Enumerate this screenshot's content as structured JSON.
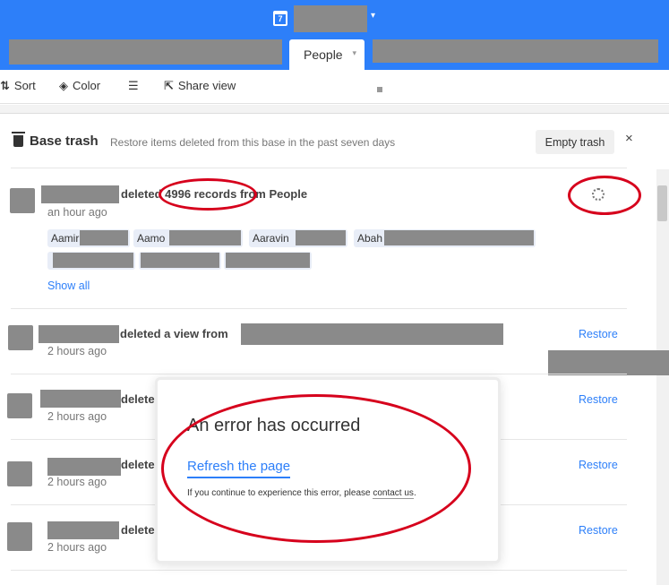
{
  "header": {
    "calendar_icon_day": "7",
    "base_menu_caret": "▾",
    "active_tab": {
      "label": "People",
      "caret": "▾"
    }
  },
  "toolbar": {
    "sort_label": "Sort",
    "color_label": "Color",
    "share_view_label": "Share view"
  },
  "trash_panel": {
    "title": "Base trash",
    "subtitle": "Restore items deleted from this base in the past seven days",
    "empty_button": "Empty trash",
    "close": "×",
    "entries": [
      {
        "action": "deleted 4996 records from People",
        "time": "an hour ago",
        "chips": [
          "Aamir",
          "Aamo",
          "Aaravin",
          "Abah"
        ],
        "show_all": "Show all",
        "restore": ""
      },
      {
        "action": "deleted a view from",
        "time": "2 hours ago",
        "restore": "Restore"
      },
      {
        "action": "delete",
        "time": "2 hours ago",
        "restore": "Restore"
      },
      {
        "action": "delete",
        "time": "2 hours ago",
        "restore": "Restore"
      },
      {
        "action": "delete",
        "time": "2 hours ago",
        "restore": "Restore"
      }
    ]
  },
  "error_modal": {
    "title": "An error has occurred",
    "refresh_link": "Refresh the page",
    "note_prefix": "If you continue to experience this error, please ",
    "contact_link": "contact us",
    "note_suffix": "."
  },
  "colors": {
    "header_blue": "#2d7ff9",
    "link_blue": "#2d7ff9",
    "annotation_red": "#d6001c",
    "redaction_gray": "#8a8a8a"
  }
}
